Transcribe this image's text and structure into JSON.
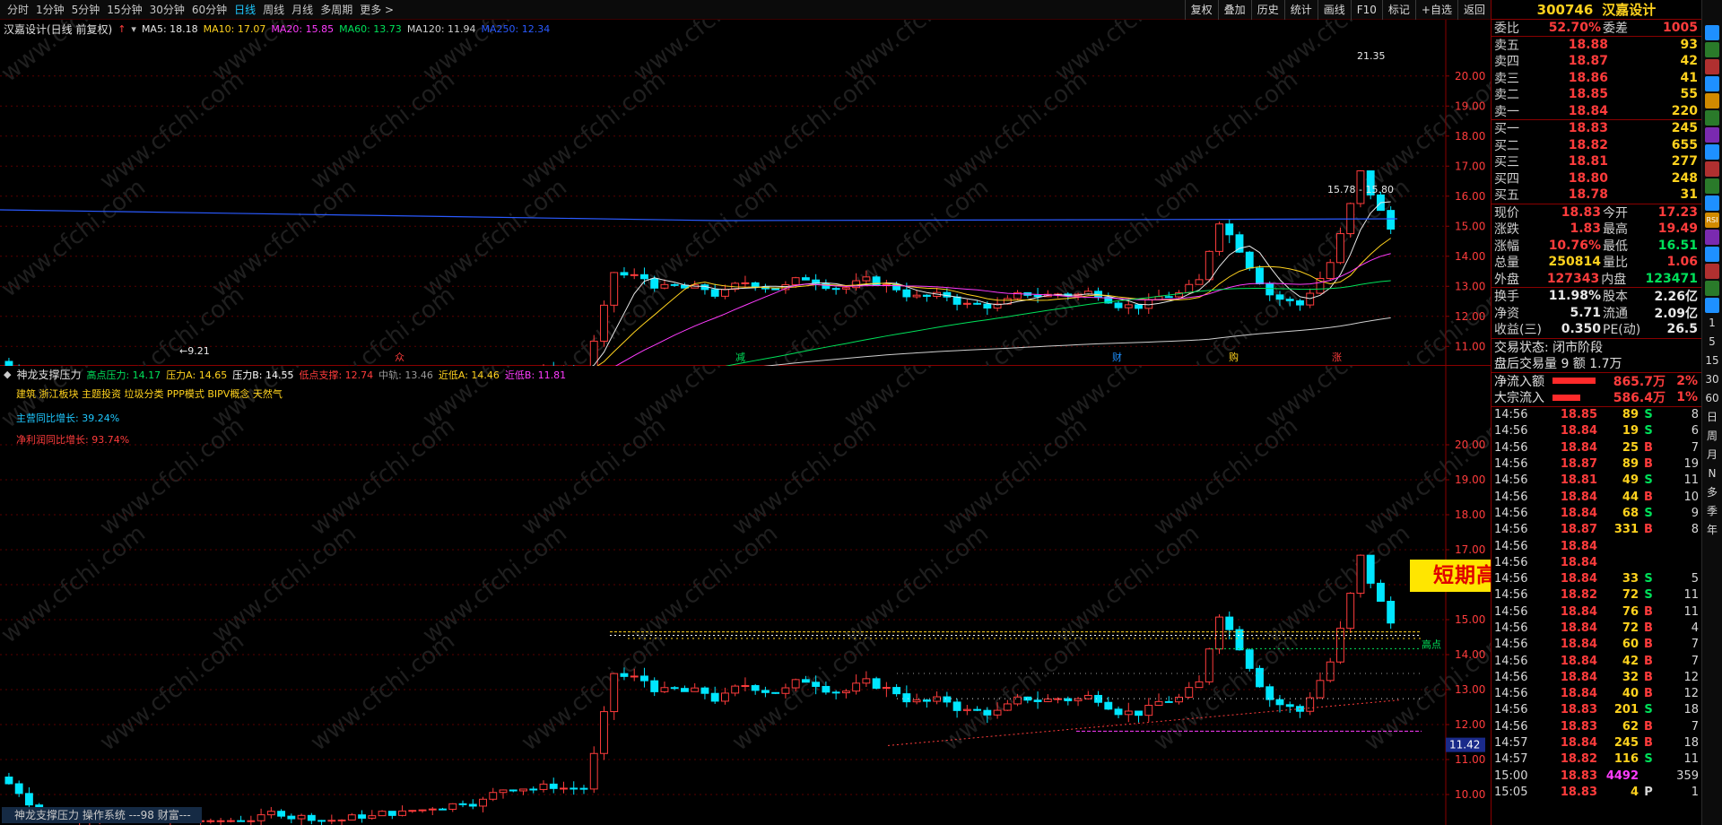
{
  "toolbar": {
    "periods": [
      "分时",
      "1分钟",
      "5分钟",
      "15分钟",
      "30分钟",
      "60分钟",
      "日线",
      "周线",
      "月线",
      "多周期",
      "更多 >"
    ],
    "active_period": "日线",
    "buttons": [
      "复权",
      "叠加",
      "历史",
      "统计",
      "画线",
      "F10",
      "标记",
      "+自选",
      "返回"
    ]
  },
  "main_chart": {
    "title": "汉嘉设计(日线 前复权)",
    "ma_legend": [
      {
        "label": "MA5: 18.18",
        "color": "#e8e8e8"
      },
      {
        "label": "MA10: 17.07",
        "color": "#ffd21e"
      },
      {
        "label": "MA20: 15.85",
        "color": "#ff3cff"
      },
      {
        "label": "MA60: 13.73",
        "color": "#00e15a"
      },
      {
        "label": "MA120: 11.94",
        "color": "#cfcfcf"
      },
      {
        "label": "MA250: 12.34",
        "color": "#2a5aff"
      }
    ],
    "y_ticks": [
      "20.00",
      "19.00",
      "18.00",
      "17.00",
      "16.00",
      "15.00",
      "14.00",
      "13.00",
      "12.00",
      "11.00",
      "10.00"
    ],
    "high_label": "21.35",
    "low_label": "9.21",
    "range_label": "15.78 - 15.80",
    "event_marks": [
      {
        "text": "众",
        "color": "#ff3c3c"
      },
      {
        "text": "减",
        "color": "#00e15a"
      },
      {
        "text": "财",
        "color": "#1e90ff"
      },
      {
        "text": "购",
        "color": "#ffd21e"
      },
      {
        "text": "涨",
        "color": "#ff3c3c"
      }
    ]
  },
  "indicator": {
    "name": "神龙支撑压力",
    "values": [
      {
        "label": "高点压力: 14.17",
        "color": "#00e15a"
      },
      {
        "label": "压力A: 14.65",
        "color": "#ffd21e"
      },
      {
        "label": "压力B: 14.55",
        "color": "#ffffff"
      },
      {
        "label": "低点支撑: 12.74",
        "color": "#ff3c3c"
      },
      {
        "label": "中轨: 13.46",
        "color": "#9a9a9a"
      },
      {
        "label": "近低A: 14.46",
        "color": "#ffd21e"
      },
      {
        "label": "近低B: 11.81",
        "color": "#ff3cff"
      }
    ],
    "concepts": "建筑 浙江板块 主题投资 垃圾分类 PPP模式 BIPV概念 天然气",
    "growth_main": "主营同比增长: 39.24%",
    "growth_profit": "净利润同比增长: 93.74%",
    "y_ticks": [
      "20.00",
      "19.00",
      "18.00",
      "17.00",
      "16.00",
      "15.00",
      "14.00",
      "13.00",
      "12.00",
      "11.00",
      "10.00"
    ],
    "current_price_tag": "11.42",
    "high_point_label": "高点",
    "banner": "短期高点冲上后回踩确立",
    "bottom_title": "神龙支撑压力 操作系统 ---98 财富---"
  },
  "right_panel": {
    "code": "300746",
    "name": "汉嘉设计",
    "weibi": {
      "label": "委比",
      "value": "52.70%",
      "label2": "委差",
      "value2": "1005"
    },
    "sell": [
      {
        "label": "卖五",
        "price": "18.88",
        "vol": "93"
      },
      {
        "label": "卖四",
        "price": "18.87",
        "vol": "42"
      },
      {
        "label": "卖三",
        "price": "18.86",
        "vol": "41"
      },
      {
        "label": "卖二",
        "price": "18.85",
        "vol": "55"
      },
      {
        "label": "卖一",
        "price": "18.84",
        "vol": "220"
      }
    ],
    "buy": [
      {
        "label": "买一",
        "price": "18.83",
        "vol": "245"
      },
      {
        "label": "买二",
        "price": "18.82",
        "vol": "655"
      },
      {
        "label": "买三",
        "price": "18.81",
        "vol": "277"
      },
      {
        "label": "买四",
        "price": "18.80",
        "vol": "248"
      },
      {
        "label": "买五",
        "price": "18.78",
        "vol": "31"
      }
    ],
    "quote": [
      {
        "l1": "现价",
        "v1": "18.83",
        "c1": "red",
        "l2": "今开",
        "v2": "17.23",
        "c2": "red"
      },
      {
        "l1": "涨跌",
        "v1": "1.83",
        "c1": "red",
        "l2": "最高",
        "v2": "19.49",
        "c2": "red"
      },
      {
        "l1": "涨幅",
        "v1": "10.76%",
        "c1": "red",
        "l2": "最低",
        "v2": "16.51",
        "c2": "green"
      },
      {
        "l1": "总量",
        "v1": "250814",
        "c1": "yellow",
        "l2": "量比",
        "v2": "1.06",
        "c2": "red"
      },
      {
        "l1": "外盘",
        "v1": "127343",
        "c1": "red",
        "l2": "内盘",
        "v2": "123471",
        "c2": "green"
      }
    ],
    "fund": [
      {
        "l1": "换手",
        "v1": "11.98%",
        "l2": "股本",
        "v2": "2.26亿"
      },
      {
        "l1": "净资",
        "v1": "5.71",
        "l2": "流通",
        "v2": "2.09亿"
      },
      {
        "l1": "收益(三)",
        "v1": "0.350",
        "l2": "PE(动)",
        "v2": "26.5"
      }
    ],
    "status": "交易状态: 闭市阶段",
    "after_hours": "盘后交易量 9 额 1.7万",
    "flows": [
      {
        "label": "净流入额",
        "value": "865.7万",
        "pct": "2%",
        "fill": 0.85
      },
      {
        "label": "大宗流入",
        "value": "586.4万",
        "pct": "1%",
        "fill": 0.55
      }
    ],
    "ticks": [
      {
        "t": "14:56",
        "p": "18.85",
        "v": "89",
        "d": "S",
        "n": "8"
      },
      {
        "t": "14:56",
        "p": "18.84",
        "v": "19",
        "d": "S",
        "n": "6"
      },
      {
        "t": "14:56",
        "p": "18.84",
        "v": "25",
        "d": "B",
        "n": "7"
      },
      {
        "t": "14:56",
        "p": "18.87",
        "v": "89",
        "d": "B",
        "n": "19"
      },
      {
        "t": "14:56",
        "p": "18.81",
        "v": "49",
        "d": "S",
        "n": "11"
      },
      {
        "t": "14:56",
        "p": "18.84",
        "v": "44",
        "d": "B",
        "n": "10"
      },
      {
        "t": "14:56",
        "p": "18.84",
        "v": "68",
        "d": "S",
        "n": "9"
      },
      {
        "t": "14:56",
        "p": "18.87",
        "v": "331",
        "d": "B",
        "n": "8"
      },
      {
        "t": "14:56",
        "p": "18.84",
        "v": "",
        "d": "",
        "n": ""
      },
      {
        "t": "14:56",
        "p": "18.84",
        "v": "",
        "d": "",
        "n": ""
      },
      {
        "t": "14:56",
        "p": "18.84",
        "v": "33",
        "d": "S",
        "n": "5"
      },
      {
        "t": "14:56",
        "p": "18.82",
        "v": "72",
        "d": "S",
        "n": "11"
      },
      {
        "t": "14:56",
        "p": "18.84",
        "v": "76",
        "d": "B",
        "n": "11"
      },
      {
        "t": "14:56",
        "p": "18.84",
        "v": "72",
        "d": "B",
        "n": "4"
      },
      {
        "t": "14:56",
        "p": "18.84",
        "v": "60",
        "d": "B",
        "n": "7"
      },
      {
        "t": "14:56",
        "p": "18.84",
        "v": "42",
        "d": "B",
        "n": "7"
      },
      {
        "t": "14:56",
        "p": "18.84",
        "v": "32",
        "d": "B",
        "n": "12"
      },
      {
        "t": "14:56",
        "p": "18.84",
        "v": "40",
        "d": "B",
        "n": "12"
      },
      {
        "t": "14:56",
        "p": "18.83",
        "v": "201",
        "d": "S",
        "n": "18"
      },
      {
        "t": "14:56",
        "p": "18.83",
        "v": "62",
        "d": "B",
        "n": "7"
      },
      {
        "t": "14:57",
        "p": "18.84",
        "v": "245",
        "d": "B",
        "n": "18"
      },
      {
        "t": "14:57",
        "p": "18.82",
        "v": "116",
        "d": "S",
        "n": "11"
      },
      {
        "t": "15:00",
        "p": "18.83",
        "v": "4492",
        "d": "",
        "n": "359"
      },
      {
        "t": "15:05",
        "p": "18.83",
        "v": "4",
        "d": "P",
        "n": "1"
      }
    ]
  },
  "side_icons": {
    "words": [
      "1",
      "5",
      "15",
      "30",
      "60",
      "日",
      "周",
      "月",
      "N",
      "多",
      "季",
      "年"
    ],
    "indicator_labels": [
      "RSI"
    ]
  },
  "watermark": "www.cfchi.com",
  "colors": {
    "up": "#ff3c3c",
    "down": "#00e6ff",
    "grid": "#5a0000",
    "accent": "#1ec8ff"
  }
}
